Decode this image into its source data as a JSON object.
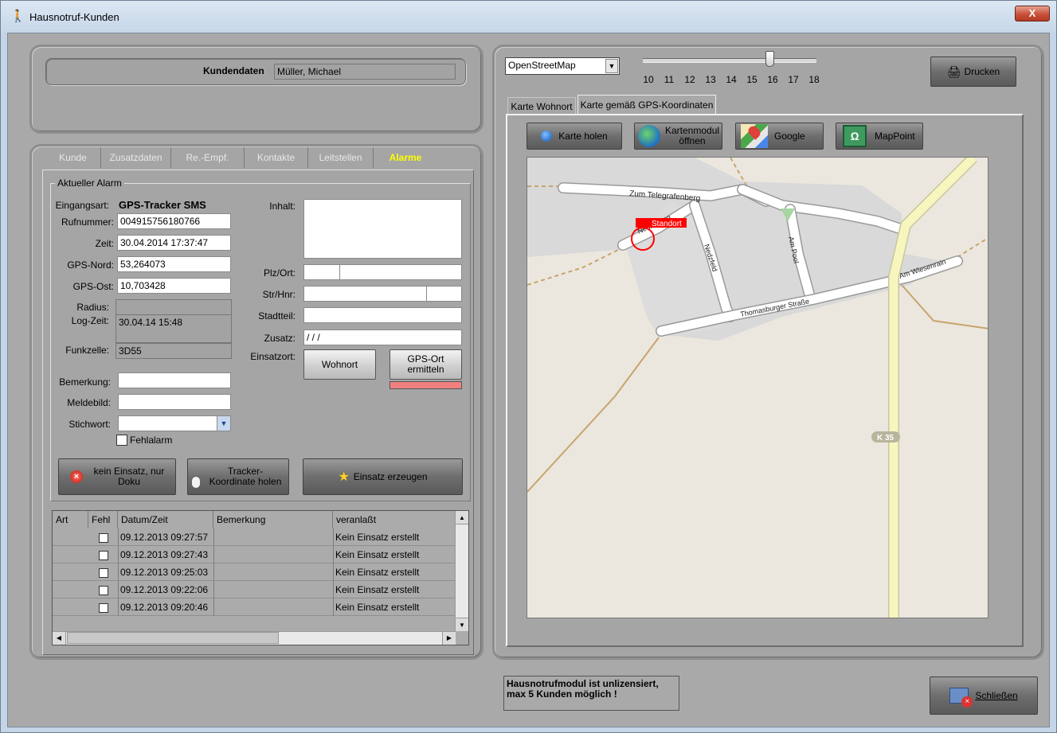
{
  "window": {
    "title": "Hausnotruf-Kunden",
    "close_label": "X"
  },
  "customer": {
    "label": "Kundendaten",
    "name": "Müller, Michael"
  },
  "tabs": [
    {
      "label": "Kunde"
    },
    {
      "label": "Zusatzdaten"
    },
    {
      "label": "Re.-Empf."
    },
    {
      "label": "Kontakte"
    },
    {
      "label": "Leitstellen"
    },
    {
      "label": "Alarme"
    }
  ],
  "alarm": {
    "group_title": "Aktueller Alarm",
    "eingangsart_label": "Eingangsart:",
    "eingangsart_value": "GPS-Tracker SMS",
    "rufnummer_label": "Rufnummer:",
    "rufnummer_value": "004915756180766",
    "zeit_label": "Zeit:",
    "zeit_value": "30.04.2014 17:37:47",
    "gps_nord_label": "GPS-Nord:",
    "gps_nord_value": "53,264073",
    "gps_ost_label": "GPS-Ost:",
    "gps_ost_value": "10,703428",
    "radius_label": "Radius:",
    "logzeit_label": "Log-Zeit:",
    "logzeit_value": "30.04.14 15:48",
    "funkzelle_label": "Funkzelle:",
    "funkzelle_value": "3D55",
    "bemerkung_label": "Bemerkung:",
    "meldebild_label": "Meldebild:",
    "stichwort_label": "Stichwort:",
    "fehlalarm_label": "Fehlalarm",
    "inhalt_label": "Inhalt:",
    "plz_label": "Plz/Ort:",
    "str_label": "Str/Hnr:",
    "stadtteil_label": "Stadtteil:",
    "zusatz_label": "Zusatz:",
    "zusatz_value": "/ / /",
    "einsatzort_label": "Einsatzort:",
    "wohnort_button": "Wohnort",
    "gps_ort_button": "GPS-Ort ermitteln",
    "kein_einsatz_button": "kein Einsatz, nur Doku",
    "tracker_button": "Tracker-Koordinate holen",
    "einsatz_button": "Einsatz erzeugen"
  },
  "grid": {
    "columns": [
      "Art",
      "Fehl",
      "Datum/Zeit",
      "Bemerkung",
      "veranlaßt"
    ],
    "rows": [
      {
        "datum": "09.12.2013 09:27:57",
        "veranlasst": "Kein Einsatz erstellt"
      },
      {
        "datum": "09.12.2013 09:27:43",
        "veranlasst": "Kein Einsatz erstellt"
      },
      {
        "datum": "09.12.2013 09:25:03",
        "veranlasst": "Kein Einsatz erstellt"
      },
      {
        "datum": "09.12.2013 09:22:06",
        "veranlasst": "Kein Einsatz erstellt"
      },
      {
        "datum": "09.12.2013 09:20:46",
        "veranlasst": "Kein Einsatz erstellt"
      }
    ]
  },
  "map": {
    "provider": "OpenStreetMap",
    "zoom_levels": [
      "10",
      "11",
      "12",
      "13",
      "14",
      "15",
      "16",
      "17",
      "18"
    ],
    "zoom_value": 16,
    "print_button": "Drucken",
    "tab_wohnort": "Karte Wohnort",
    "tab_gps": "Karte gemäß GPS-Koordinaten",
    "btn_karte_holen": "Karte holen",
    "btn_kartenmodul": "Kartenmodul öffnen",
    "btn_google": "Google",
    "btn_mappoint": "MapPoint",
    "marker_label": "Standort",
    "streets": {
      "zum_telegrafenberg": "Zum Telegrafenberg",
      "nedz": "Nedz...weg",
      "nedzfeld": "Nedzfeld",
      "am_pool": "Am Pool",
      "thomasburger": "Thomasburger Straße",
      "am_wiesenrain": "Am Wiesenrain",
      "k35": "K 35"
    }
  },
  "footer": {
    "license_text": "Hausnotrufmodul ist unlizensiert, max 5 Kunden möglich !",
    "close_button": "Schließen"
  },
  "colors": {
    "accent_tab": "#ffff00",
    "marker": "#ff0000",
    "gps_indicator": "#f08080"
  }
}
